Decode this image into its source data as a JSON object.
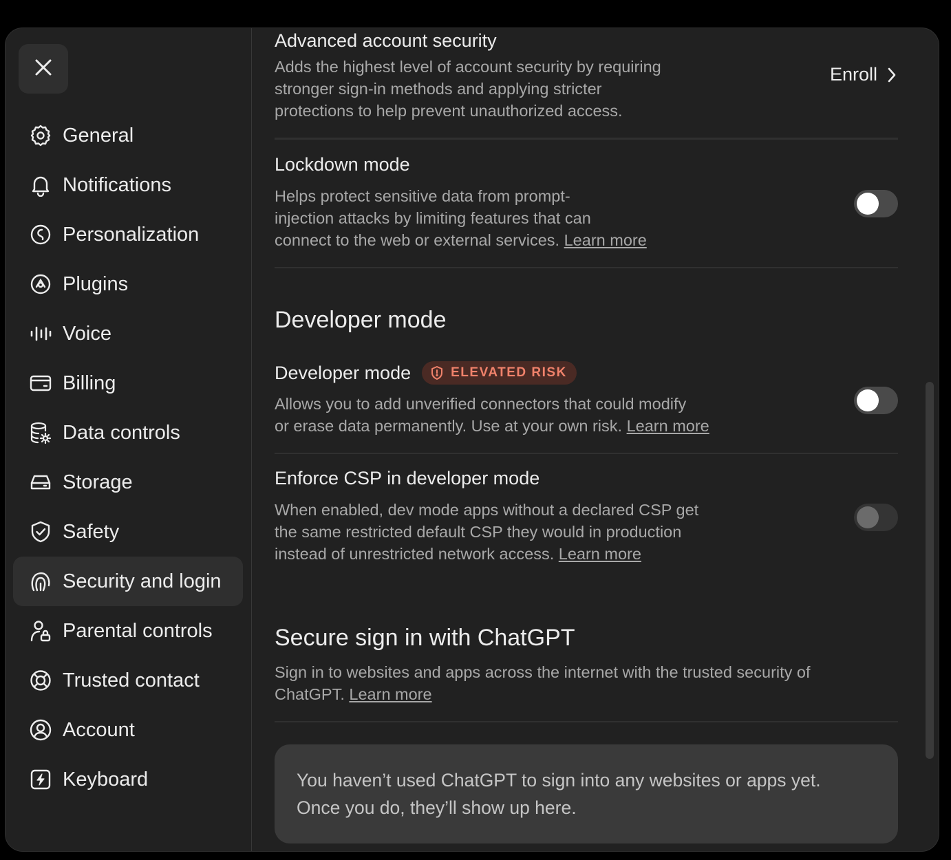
{
  "sidebar": {
    "items": [
      {
        "label": "General",
        "icon": "gear-icon"
      },
      {
        "label": "Notifications",
        "icon": "bell-icon"
      },
      {
        "label": "Personalization",
        "icon": "personalization-icon"
      },
      {
        "label": "Plugins",
        "icon": "plugins-icon"
      },
      {
        "label": "Voice",
        "icon": "voice-waveform-icon"
      },
      {
        "label": "Billing",
        "icon": "credit-card-icon"
      },
      {
        "label": "Data controls",
        "icon": "database-gear-icon"
      },
      {
        "label": "Storage",
        "icon": "hard-drive-icon"
      },
      {
        "label": "Safety",
        "icon": "shield-check-icon"
      },
      {
        "label": "Security and login",
        "icon": "security-login-icon",
        "active": true
      },
      {
        "label": "Parental controls",
        "icon": "user-lock-icon"
      },
      {
        "label": "Trusted contact",
        "icon": "lifebuoy-icon"
      },
      {
        "label": "Account",
        "icon": "user-circle-icon"
      },
      {
        "label": "Keyboard",
        "icon": "keyboard-bolt-icon"
      }
    ]
  },
  "advanced_security": {
    "title": "Advanced account security",
    "desc_lines": [
      "Adds the highest level of account security by requiring",
      "stronger sign-in methods and applying stricter",
      "protections to help prevent unauthorized access."
    ],
    "action_label": "Enroll"
  },
  "lockdown": {
    "title": "Lockdown mode",
    "desc_lines": [
      "Helps protect sensitive data from prompt-",
      "injection attacks by limiting features that can",
      "connect to the web or external services."
    ],
    "link": "Learn more",
    "enabled": false
  },
  "developer_section": {
    "heading": "Developer mode",
    "developer_mode": {
      "title": "Developer mode",
      "badge": "ELEVATED RISK",
      "desc_lines": [
        "Allows you to add unverified connectors that could modify",
        "or erase data permanently. Use at your own risk."
      ],
      "link": "Learn more",
      "enabled": false
    },
    "enforce_csp": {
      "title": "Enforce CSP in developer mode",
      "desc_lines": [
        "When enabled, dev mode apps without a declared CSP get",
        "the same restricted default CSP they would in production",
        "instead of unrestricted network access."
      ],
      "link": "Learn more",
      "enabled": false,
      "disabled": true
    }
  },
  "secure_signin": {
    "heading": "Secure sign in with ChatGPT",
    "desc_lines": [
      "Sign in to websites and apps across the internet with the trusted security of",
      "ChatGPT."
    ],
    "link": "Learn more",
    "empty_lines": [
      "You haven’t used ChatGPT to sign into any websites or apps yet.",
      "Once you do, they’ll show up here."
    ]
  },
  "colors": {
    "background": "#212121",
    "badge_text": "#f0826b",
    "badge_bg": "#4a2a24"
  }
}
